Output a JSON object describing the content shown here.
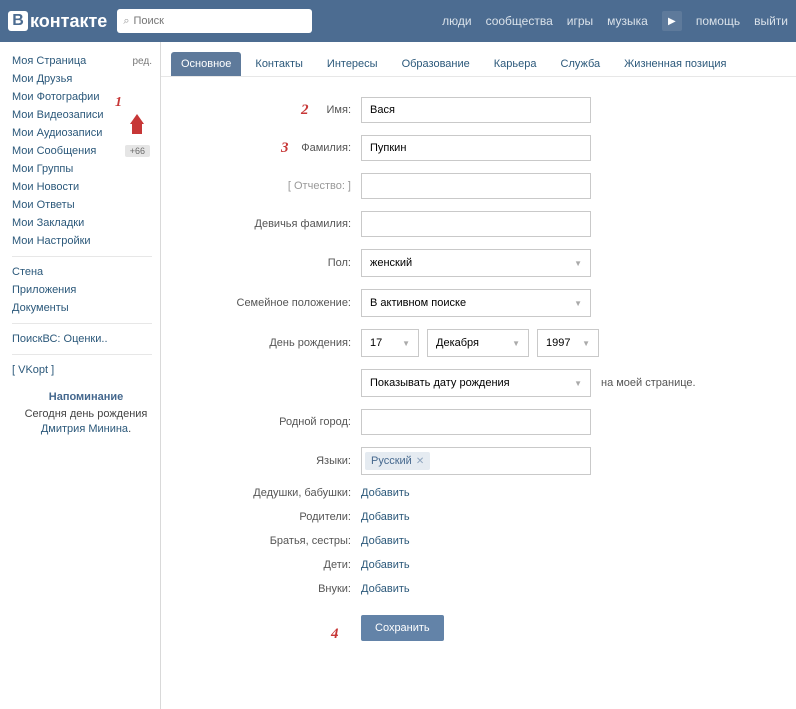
{
  "header": {
    "logo": "контакте",
    "search_placeholder": "Поиск",
    "nav": [
      "люди",
      "сообщества",
      "игры",
      "музыка",
      "помощь",
      "выйти"
    ]
  },
  "sidebar": {
    "items": [
      {
        "label": "Моя Страница",
        "edit": "ред."
      },
      {
        "label": "Мои Друзья"
      },
      {
        "label": "Мои Фотографии"
      },
      {
        "label": "Мои Видеозаписи"
      },
      {
        "label": "Мои Аудиозаписи"
      },
      {
        "label": "Мои Сообщения",
        "badge": "+66"
      },
      {
        "label": "Мои Группы"
      },
      {
        "label": "Мои Новости"
      },
      {
        "label": "Мои Ответы"
      },
      {
        "label": "Мои Закладки"
      },
      {
        "label": "Мои Настройки"
      }
    ],
    "extra": [
      "Стена",
      "Приложения",
      "Документы"
    ],
    "search_link": "ПоискВС: Оценки..",
    "vkopt": "[ VKopt ]",
    "reminder": {
      "title": "Напоминание",
      "text_before": "Сегодня ",
      "text_mid": "день рождения ",
      "link": "Дмитрия Минина",
      "text_after": "."
    }
  },
  "tabs": [
    "Основное",
    "Контакты",
    "Интересы",
    "Образование",
    "Карьера",
    "Служба",
    "Жизненная позиция"
  ],
  "form": {
    "name_label": "Имя:",
    "name_value": "Вася",
    "surname_label": "Фамилия:",
    "surname_value": "Пупкин",
    "patronymic_label": "[ Отчество: ]",
    "maiden_label": "Девичья фамилия:",
    "gender_label": "Пол:",
    "gender_value": "женский",
    "marital_label": "Семейное положение:",
    "marital_value": "В активном поиске",
    "birthday_label": "День рождения:",
    "bday_day": "17",
    "bday_month": "Декабря",
    "bday_year": "1997",
    "bday_show": "Показывать дату рождения",
    "bday_after": "на моей странице.",
    "hometown_label": "Родной город:",
    "languages_label": "Языки:",
    "language_tag": "Русский",
    "grandparents_label": "Дедушки, бабушки:",
    "parents_label": "Родители:",
    "siblings_label": "Братья, сестры:",
    "children_label": "Дети:",
    "grandchildren_label": "Внуки:",
    "add_link": "Добавить",
    "save_button": "Сохранить"
  },
  "annotations": {
    "a1": "1",
    "a2": "2",
    "a3": "3",
    "a4": "4"
  }
}
